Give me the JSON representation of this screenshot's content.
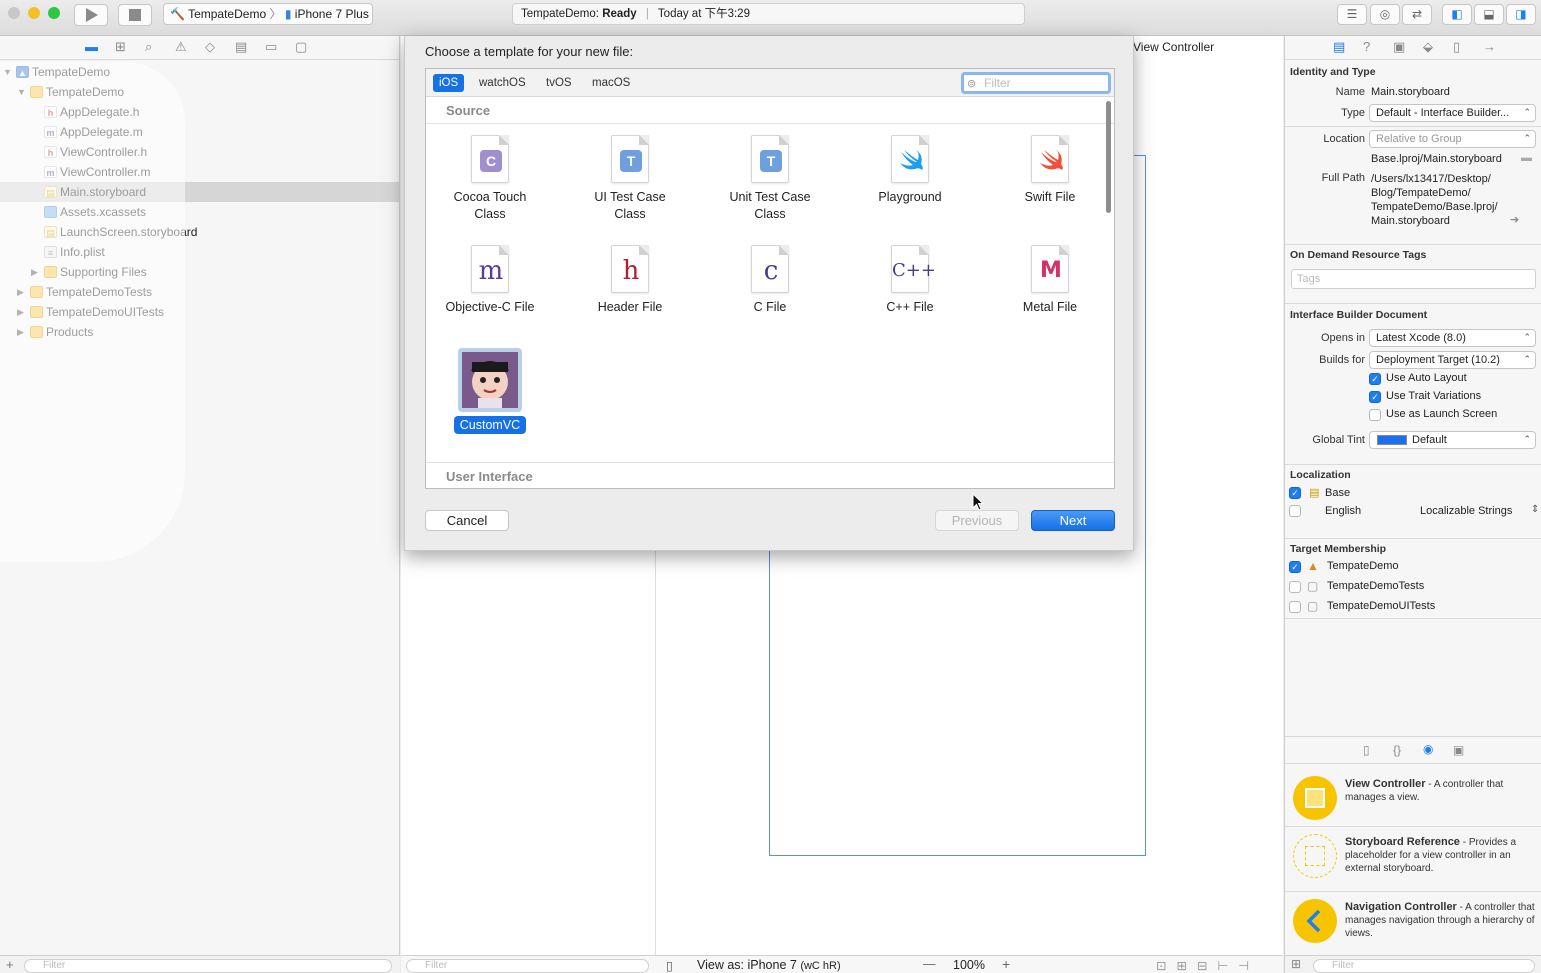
{
  "toolbar": {
    "scheme_project": "TempateDemo",
    "scheme_device": "iPhone 7 Plus",
    "activity_project": "TempateDemo:",
    "activity_status": "Ready",
    "activity_time": "Today at 下午3:29"
  },
  "navigator": {
    "items": [
      {
        "label": "TempateDemo",
        "kind": "project"
      },
      {
        "label": "TempateDemo",
        "kind": "folder"
      },
      {
        "label": "AppDelegate.h",
        "kind": "h"
      },
      {
        "label": "AppDelegate.m",
        "kind": "m"
      },
      {
        "label": "ViewController.h",
        "kind": "h"
      },
      {
        "label": "ViewController.m",
        "kind": "m"
      },
      {
        "label": "Main.storyboard",
        "kind": "storyboard"
      },
      {
        "label": "Assets.xcassets",
        "kind": "assets"
      },
      {
        "label": "LaunchScreen.storyboard",
        "kind": "storyboard"
      },
      {
        "label": "Info.plist",
        "kind": "plist"
      },
      {
        "label": "Supporting Files",
        "kind": "folder"
      },
      {
        "label": "TempateDemoTests",
        "kind": "folder"
      },
      {
        "label": "TempateDemoUITests",
        "kind": "folder"
      },
      {
        "label": "Products",
        "kind": "folder"
      }
    ],
    "filter_placeholder": "Filter"
  },
  "editor": {
    "scene_label": "View Controller",
    "view_as": "View as: iPhone 7",
    "size_class": "(wC hR)",
    "zoom": "100%",
    "minus": "—",
    "plus": "+",
    "filter_placeholder": "Filter"
  },
  "sheet": {
    "title": "Choose a template for your new file:",
    "tabs": [
      "iOS",
      "watchOS",
      "tvOS",
      "macOS"
    ],
    "filter_placeholder": "Filter",
    "section_source": "Source",
    "section_ui": "User Interface",
    "templates": [
      {
        "line1": "Cocoa Touch",
        "line2": "Class",
        "glyph": "C"
      },
      {
        "line1": "UI Test Case",
        "line2": "Class",
        "glyph": "T"
      },
      {
        "line1": "Unit Test Case",
        "line2": "Class",
        "glyph": "T"
      },
      {
        "line1": "Playground",
        "line2": "",
        "glyph": "swift"
      },
      {
        "line1": "Swift File",
        "line2": "",
        "glyph": "swift"
      },
      {
        "line1": "Objective-C File",
        "line2": "",
        "glyph": "m"
      },
      {
        "line1": "Header File",
        "line2": "",
        "glyph": "h"
      },
      {
        "line1": "C File",
        "line2": "",
        "glyph": "c"
      },
      {
        "line1": "C++ File",
        "line2": "",
        "glyph": "C++"
      },
      {
        "line1": "Metal File",
        "line2": "",
        "glyph": "M"
      }
    ],
    "custom_template": "CustomVC",
    "cancel": "Cancel",
    "previous": "Previous",
    "next": "Next"
  },
  "inspector": {
    "identity_header": "Identity and Type",
    "name_label": "Name",
    "name_value": "Main.storyboard",
    "type_label": "Type",
    "type_value": "Default - Interface Builder...",
    "location_label": "Location",
    "location_value": "Relative to Group",
    "location_path": "Base.lproj/Main.storyboard",
    "fullpath_label": "Full Path",
    "fullpath_lines": [
      "/Users/lx13417/Desktop/",
      "Blog/TempateDemo/",
      "TempateDemo/Base.lproj/",
      "Main.storyboard"
    ],
    "ondemand_header": "On Demand Resource Tags",
    "tags_placeholder": "Tags",
    "ibdoc_header": "Interface Builder Document",
    "opens_label": "Opens in",
    "opens_value": "Latest Xcode (8.0)",
    "builds_label": "Builds for",
    "builds_value": "Deployment Target (10.2)",
    "checks": [
      {
        "label": "Use Auto Layout",
        "checked": true
      },
      {
        "label": "Use Trait Variations",
        "checked": true
      },
      {
        "label": "Use as Launch Screen",
        "checked": false
      }
    ],
    "tint_label": "Global Tint",
    "tint_value": "Default",
    "tint_color": "#1d6ff0",
    "localization_header": "Localization",
    "loc_base": "Base",
    "loc_english": "English",
    "loc_english_type": "Localizable Strings",
    "target_header": "Target Membership",
    "targets": [
      {
        "label": "TempateDemo",
        "checked": true
      },
      {
        "label": "TempateDemoTests",
        "checked": false
      },
      {
        "label": "TempateDemoUITests",
        "checked": false
      }
    ],
    "library": [
      {
        "title": "View Controller",
        "desc": " - A controller that manages a view."
      },
      {
        "title": "Storyboard Reference",
        "desc": " - Provides a placeholder for a view controller in an external storyboard."
      },
      {
        "title": "Navigation Controller",
        "desc": " - A controller that manages navigation through a hierarchy of views."
      }
    ],
    "filter_placeholder": "Filter"
  },
  "colors": {
    "accent": "#1670e6",
    "library_yellow": "#f7c500"
  }
}
